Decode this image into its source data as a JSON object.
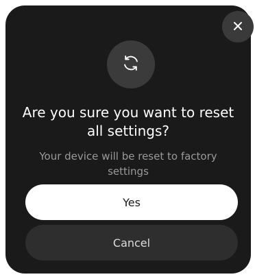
{
  "dialog": {
    "title": "Are you sure you want to reset all settings?",
    "subtitle": "Your device will be reset to factory settings",
    "icon": "refresh-icon",
    "close_icon": "close-icon"
  },
  "actions": {
    "yes_label": "Yes",
    "cancel_label": "Cancel"
  },
  "colors": {
    "dialog_bg": "#1a1a1a",
    "icon_circle_bg": "#3b3b3b",
    "primary_button_bg": "#ffffff",
    "secondary_button_bg": "#2e2e2e",
    "subtitle_text": "#9a9a9a"
  }
}
